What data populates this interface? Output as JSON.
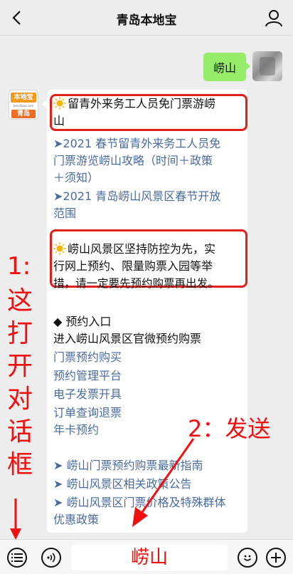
{
  "header": {
    "title": "青岛本地宝"
  },
  "outgoing": {
    "text": "崂山"
  },
  "bot": {
    "logo_top": "本地宝",
    "logo_mid": "bendibao.com",
    "logo_bottom": "青岛"
  },
  "card": {
    "box1": {
      "line1": "留青外来务工人员免门票游崂",
      "line2": "山"
    },
    "links1": [
      {
        "line1": "➤2021 春节留青外来务工人员免",
        "line2": "门票游览崂山攻略（时间＋政策",
        "line3": "＋须知）"
      },
      {
        "line1": "➤2021 青岛崂山风景区春节开放",
        "line2": "范围"
      }
    ],
    "box2": {
      "line1": "崂山风景区坚持防控为先，实",
      "line2": "行网上预约、限量购票入园等举",
      "line3": "措，请一定要先预约购票再出发。"
    },
    "reserve": {
      "heading": "◆ 预约入口",
      "subheading": "进入崂山风景区官微预约购票",
      "items": [
        "门票预约购买",
        "预约管理平台",
        "电子发票开具",
        "订单查询退票",
        "年卡预约"
      ]
    },
    "links2": [
      {
        "line1": "➤ 崂山门票预约购票最新指南"
      },
      {
        "line1": "➤ 崂山风景区相关政策公告"
      },
      {
        "line1": "➤ 崂山风景区门票价格及特殊群体",
        "line2": "优惠政策"
      }
    ]
  },
  "annotations": {
    "step1_number": "1:",
    "step1_text": [
      "这",
      "打",
      "开",
      "对",
      "话",
      "框"
    ],
    "step2": "2：发送",
    "input_text": "崂山",
    "color": "#f01010"
  },
  "icons": [
    "back-chevron",
    "user",
    "sun",
    "menu-list",
    "voice",
    "emoji",
    "plus"
  ]
}
